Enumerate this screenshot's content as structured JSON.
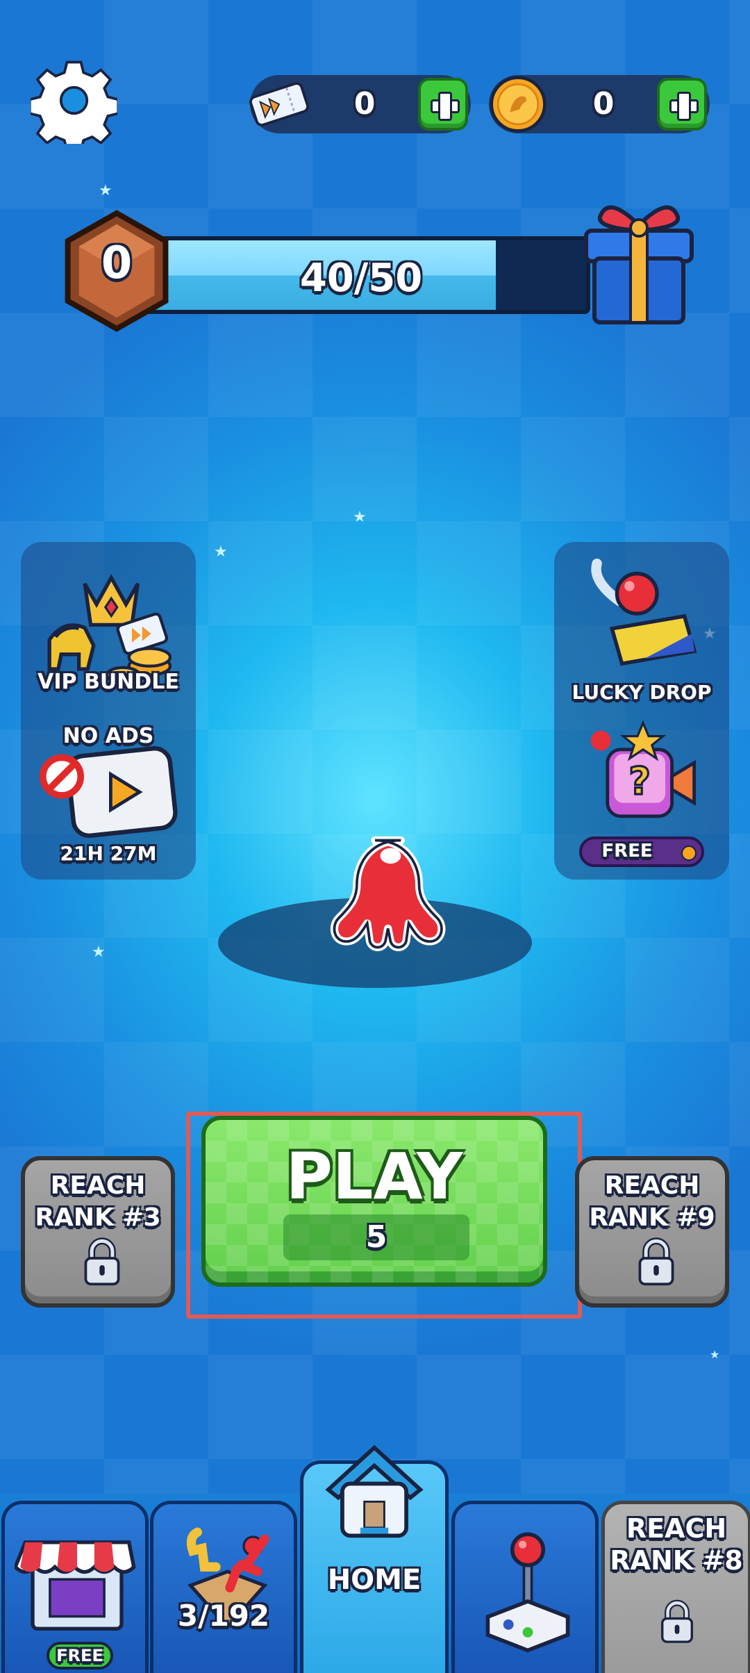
{
  "top_bar": {
    "tickets_value": "0",
    "coins_value": "0"
  },
  "rank": {
    "level": "0",
    "progress_text": "40/50",
    "progress_fraction": 0.8
  },
  "left_panel": {
    "vip_label": "VIP BUNDLE",
    "no_ads_label": "NO ADS",
    "timer": "21H 27M"
  },
  "right_panel": {
    "lucky_drop_label": "LUCKY DROP",
    "free_label": "FREE"
  },
  "play": {
    "label": "PLAY",
    "level": "5"
  },
  "locked_left": {
    "line1": "REACH",
    "line2": "RANK #3"
  },
  "locked_right": {
    "line1": "REACH",
    "line2": "RANK #9"
  },
  "bottom_nav": {
    "shop_badge": "FREE",
    "collection_count": "3/192",
    "home_label": "HOME",
    "locked_line1": "REACH",
    "locked_line2": "RANK #8"
  },
  "colors": {
    "accent_green": "#64d04d",
    "highlight": "#e05a56",
    "background": "#1fb8f0"
  }
}
